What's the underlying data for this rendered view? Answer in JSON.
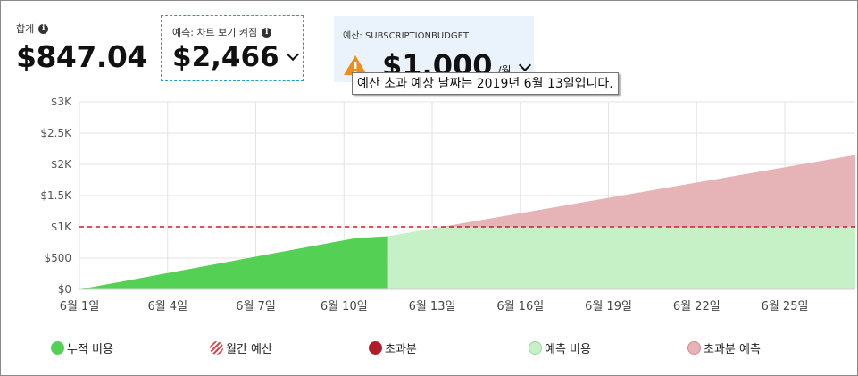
{
  "kpis": {
    "total": {
      "label": "합계",
      "value": "$847.04"
    },
    "forecast": {
      "label": "예측: 차트 보기 켜짐",
      "value": "$2,466"
    },
    "budget": {
      "label": "예산: SUBSCRIPTIONBUDGET",
      "value": "$1,000",
      "per": "/월"
    }
  },
  "tooltip": "예산 초과 예상 날짜는 2019년 6월 13일입니다.",
  "colors": {
    "actual": "#54d154",
    "forecast": "#c6f0c6",
    "over_forecast": "#e6b3b6",
    "budget_line": "#cc1f2a",
    "over": "#b01c2a",
    "warning": "#f08c1c"
  },
  "legend": [
    {
      "label": "누적 비용",
      "style": "actual"
    },
    {
      "label": "월간 예산",
      "style": "budget"
    },
    {
      "label": "초과분",
      "style": "over"
    },
    {
      "label": "예측 비용",
      "style": "forecast"
    },
    {
      "label": "초과분 예측",
      "style": "over_forecast"
    }
  ],
  "chart_data": {
    "type": "area",
    "x_ticks": [
      "6월 1일",
      "6월 4일",
      "6월 7일",
      "6월 10일",
      "6월 13일",
      "6월 16일",
      "6월 19일",
      "6월 22일",
      "6월 25일"
    ],
    "x_tick_days": [
      1,
      4,
      7,
      10,
      13,
      16,
      19,
      22,
      25
    ],
    "y_ticks": [
      "$0",
      "$500",
      "$1K",
      "$1.5K",
      "$2K",
      "$2.5K",
      "$3K"
    ],
    "y_tick_values": [
      0,
      500,
      1000,
      1500,
      2000,
      2500,
      3000
    ],
    "ylim": [
      0,
      3000
    ],
    "xlim": [
      1,
      27.4
    ],
    "budget": 1000,
    "series": [
      {
        "name": "누적 비용",
        "x": [
          1,
          10.4,
          11.5
        ],
        "values": [
          0,
          820,
          850
        ]
      },
      {
        "name": "예측 비용",
        "x": [
          11.5,
          27.4
        ],
        "values": [
          850,
          2150
        ]
      }
    ],
    "grid": true,
    "legend_position": "bottom"
  }
}
